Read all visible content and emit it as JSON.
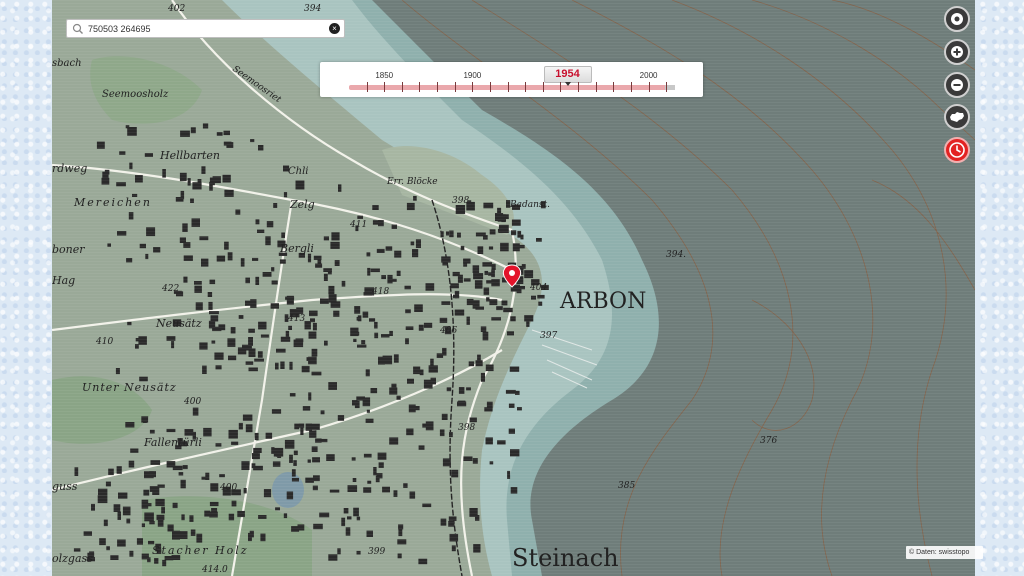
{
  "search": {
    "value": "750503 264695",
    "clear_glyph": "×"
  },
  "timeline": {
    "year_labels": [
      "1850",
      "1900",
      "2000"
    ],
    "start_year": 1830,
    "end_year": 2015,
    "selected_year": "1954"
  },
  "controls": [
    {
      "name": "locate-button",
      "icon": "target-icon"
    },
    {
      "name": "zoom-in-button",
      "icon": "plus-icon"
    },
    {
      "name": "zoom-out-button",
      "icon": "minus-icon"
    },
    {
      "name": "switzerland-view-button",
      "icon": "switzerland-icon"
    },
    {
      "name": "timetravel-button",
      "icon": "clock-icon"
    }
  ],
  "attribution": "© Daten: swisstopo",
  "map_labels": {
    "town": "ARBON",
    "town2": "Steinach",
    "l1": "Hellbarten",
    "l2": "Mereichen",
    "l3": "Zelg",
    "l4": "Bergli",
    "l5": "Neusätz",
    "l6": "Unter Neusätz",
    "l7": "Fallentürli",
    "l8": "Seemoosholz",
    "l9": "Stacher Holz",
    "l10": "Err. Blöcke",
    "l11": "Badanst.",
    "l12": "Seemoosriet",
    "l13": "Chli",
    "l14": "rdweg",
    "l15": "boner",
    "l16": "Hag",
    "l17": "guss",
    "l18": "olzgass",
    "l19": "sbach",
    "e1": "394.",
    "e2": "376",
    "e3": "385",
    "e4": "394",
    "e5": "398",
    "e6": "397",
    "e7": "398",
    "e8": "399",
    "e9": "411",
    "e10": "413",
    "e11": "418",
    "e12": "410",
    "e13": "400",
    "e14": "404",
    "e15": "406",
    "e16": "402",
    "e17": "414.0",
    "e18": "400",
    "e19": "422"
  },
  "colors": {
    "lake": "#6d7b78",
    "land": "#9fae9e",
    "marker": "#e3142b",
    "timeline_track": "#eaa8ac",
    "selected_year": "#c8102e"
  }
}
